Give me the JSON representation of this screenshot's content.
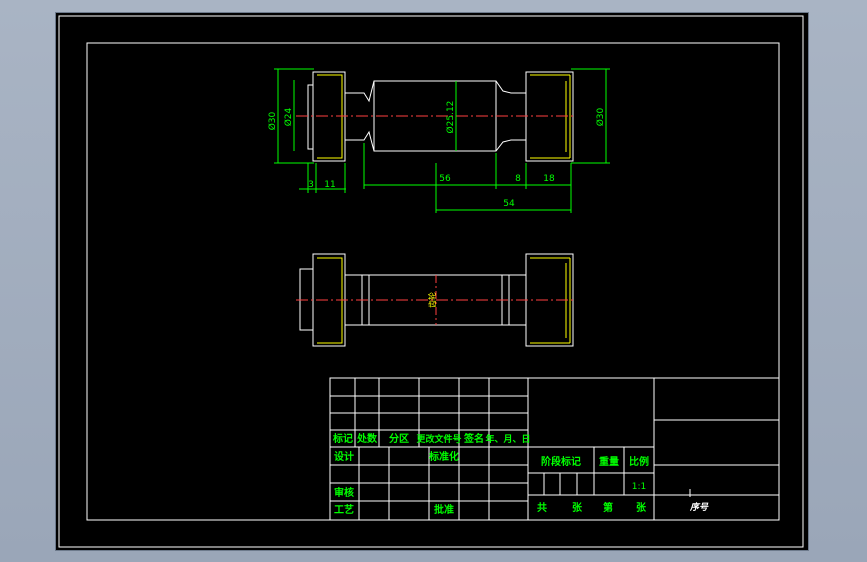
{
  "colors": {
    "background": "#000000",
    "frame": "#ffffff",
    "outline": "#ffffff",
    "yellow": "#ffff00",
    "dim": "#00ff00",
    "center": "#ff4040",
    "titletext": "#00ff00"
  },
  "dimensions": {
    "d_left_outer": "Ø30",
    "d_left_inner": "Ø24",
    "d_mid": "Ø25.12",
    "d_right": "Ø30",
    "len_3": "3",
    "len_11": "11",
    "len_56": "56",
    "len_8": "8",
    "len_18": "18",
    "len_54": "54"
  },
  "bottom_view_label": "齿轮",
  "title_block": {
    "mark": "标记",
    "count": "处数",
    "zone": "分区",
    "change_doc": "更改文件号",
    "signature": "签名",
    "date": "年、月、日",
    "design": "设计",
    "standardize": "标准化",
    "review": "审核",
    "process": "工艺",
    "approve": "批准",
    "stage_mark": "阶段标记",
    "weight": "重量",
    "scale_label": "比例",
    "scale_value": "1:1",
    "total": "共",
    "sheets": "张",
    "sheet_no": "第",
    "sheet_unit": "张",
    "seq_no": "序号"
  }
}
